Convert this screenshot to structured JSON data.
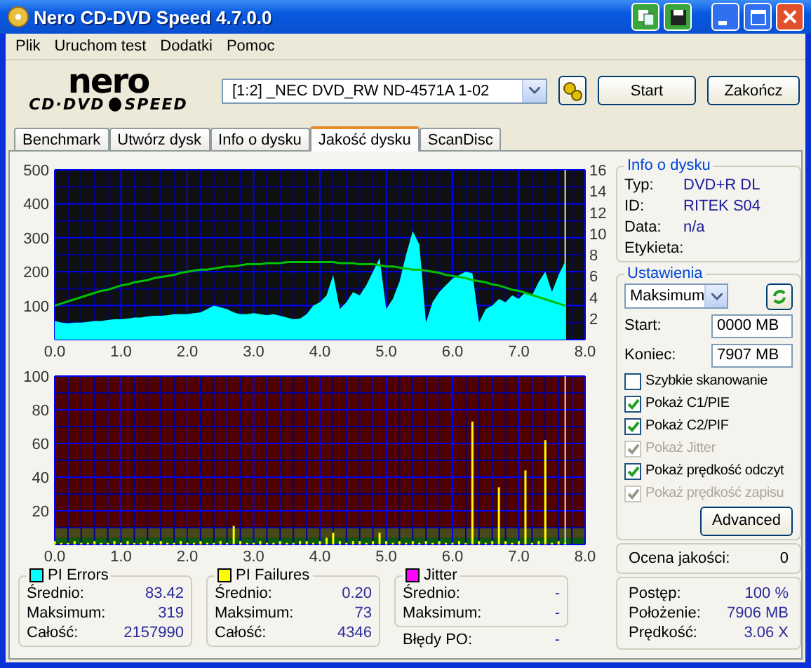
{
  "window": {
    "title": "Nero CD-DVD Speed 4.7.0.0"
  },
  "menu": [
    "Plik",
    "Uruchom test",
    "Dodatki",
    "Pomoc"
  ],
  "logo": {
    "top": "nero",
    "left": "CD·DVD",
    "right": "SPEED"
  },
  "drive": {
    "value": "[1:2]   _NEC DVD_RW ND-4571A 1-02"
  },
  "buttons": {
    "start": "Start",
    "exit": "Zakończ"
  },
  "tabs": [
    {
      "label": "Benchmark",
      "selected": false
    },
    {
      "label": "Utwórz dysk",
      "selected": false
    },
    {
      "label": "Info o dysku",
      "selected": false
    },
    {
      "label": "Jakość dysku",
      "selected": true
    },
    {
      "label": "ScanDisc",
      "selected": false
    }
  ],
  "pi_chart": {
    "chart_data": {
      "type": "area",
      "xlim": [
        0,
        8
      ],
      "ylim": [
        0,
        500
      ],
      "xticks": [
        {
          "value": 0,
          "label": "0.0"
        },
        {
          "value": 1,
          "label": "1.0"
        },
        {
          "value": 2,
          "label": "2.0"
        },
        {
          "value": 3,
          "label": "3.0"
        },
        {
          "value": 4,
          "label": "4.0"
        },
        {
          "value": 5,
          "label": "5.0"
        },
        {
          "value": 6,
          "label": "6.0"
        },
        {
          "value": 7,
          "label": "7.0"
        },
        {
          "value": 8,
          "label": "8.0"
        }
      ],
      "yticks": [
        100,
        200,
        300,
        400,
        500
      ],
      "y2lim": [
        0,
        16
      ],
      "grid": true,
      "y2ticks": [
        2,
        4,
        6,
        8,
        10,
        12,
        14,
        16
      ],
      "x": [
        0.0,
        0.1,
        0.2,
        0.3,
        0.4,
        0.5,
        0.6,
        0.7,
        0.8,
        0.9,
        1.0,
        1.1,
        1.2,
        1.3,
        1.4,
        1.5,
        1.6,
        1.7,
        1.8,
        1.9,
        2.0,
        2.1,
        2.2,
        2.3,
        2.4,
        2.5,
        2.6,
        2.7,
        2.8,
        2.9,
        3.0,
        3.1,
        3.2,
        3.3,
        3.4,
        3.5,
        3.6,
        3.7,
        3.8,
        3.9,
        4.0,
        4.1,
        4.2,
        4.3,
        4.4,
        4.5,
        4.6,
        4.7,
        4.8,
        4.9,
        5.0,
        5.1,
        5.2,
        5.3,
        5.4,
        5.5,
        5.6,
        5.7,
        5.8,
        5.9,
        6.0,
        6.1,
        6.2,
        6.3,
        6.4,
        6.5,
        6.6,
        6.7,
        6.8,
        6.9,
        7.0,
        7.1,
        7.2,
        7.3,
        7.4,
        7.5,
        7.6,
        7.7
      ],
      "series": [
        {
          "color": "#00ffff",
          "type": "area",
          "values": [
            55,
            50,
            48,
            50,
            50,
            52,
            55,
            55,
            58,
            60,
            60,
            62,
            65,
            65,
            68,
            70,
            70,
            72,
            75,
            75,
            75,
            78,
            80,
            90,
            100,
            95,
            90,
            80,
            75,
            75,
            78,
            75,
            72,
            75,
            70,
            65,
            60,
            62,
            75,
            100,
            110,
            130,
            190,
            90,
            110,
            140,
            130,
            160,
            200,
            240,
            90,
            120,
            170,
            250,
            319,
            280,
            50,
            110,
            140,
            160,
            180,
            190,
            200,
            195,
            50,
            90,
            100,
            120,
            110,
            130,
            120,
            140,
            130,
            170,
            200,
            140,
            190,
            230
          ]
        },
        {
          "color": "#00c000",
          "type": "line",
          "axis": "y2",
          "values": [
            3.2,
            3.4,
            3.6,
            3.8,
            4.0,
            4.2,
            4.4,
            4.6,
            4.7,
            4.9,
            5.1,
            5.2,
            5.4,
            5.5,
            5.6,
            5.8,
            5.9,
            6.0,
            6.1,
            6.3,
            6.4,
            6.5,
            6.6,
            6.6,
            6.7,
            6.8,
            6.9,
            6.9,
            7.0,
            7.1,
            7.1,
            7.1,
            7.2,
            7.2,
            7.2,
            7.3,
            7.3,
            7.3,
            7.3,
            7.3,
            7.3,
            7.3,
            7.3,
            7.2,
            7.2,
            7.2,
            7.1,
            7.1,
            7.1,
            7.0,
            6.9,
            6.9,
            6.8,
            6.7,
            6.6,
            6.6,
            6.5,
            6.4,
            6.3,
            6.1,
            6.0,
            5.9,
            5.8,
            5.6,
            5.5,
            5.4,
            5.2,
            5.1,
            4.9,
            4.7,
            4.6,
            4.4,
            4.2,
            4.0,
            3.8,
            3.6,
            3.4,
            3.2
          ]
        }
      ]
    }
  },
  "pif_chart": {
    "chart_data": {
      "type": "bar",
      "xlim": [
        0,
        8
      ],
      "ylim": [
        0,
        100
      ],
      "xticks": [
        {
          "value": 0,
          "label": "0.0"
        },
        {
          "value": 1,
          "label": "1.0"
        },
        {
          "value": 2,
          "label": "2.0"
        },
        {
          "value": 3,
          "label": "3.0"
        },
        {
          "value": 4,
          "label": "4.0"
        },
        {
          "value": 5,
          "label": "5.0"
        },
        {
          "value": 6,
          "label": "6.0"
        },
        {
          "value": 7,
          "label": "7.0"
        },
        {
          "value": 8,
          "label": "8.0"
        }
      ],
      "yticks": [
        20,
        40,
        60,
        80,
        100
      ],
      "grid": true,
      "x": [
        0.0,
        0.1,
        0.2,
        0.3,
        0.4,
        0.5,
        0.6,
        0.7,
        0.8,
        0.9,
        1.0,
        1.1,
        1.2,
        1.3,
        1.4,
        1.5,
        1.6,
        1.7,
        1.8,
        1.9,
        2.0,
        2.1,
        2.2,
        2.3,
        2.4,
        2.5,
        2.6,
        2.7,
        2.8,
        2.9,
        3.0,
        3.1,
        3.2,
        3.3,
        3.4,
        3.5,
        3.6,
        3.7,
        3.8,
        3.9,
        4.0,
        4.1,
        4.2,
        4.3,
        4.4,
        4.5,
        4.6,
        4.7,
        4.8,
        4.9,
        5.0,
        5.1,
        5.2,
        5.3,
        5.4,
        5.5,
        5.6,
        5.7,
        5.8,
        5.9,
        6.0,
        6.1,
        6.2,
        6.3,
        6.4,
        6.5,
        6.6,
        6.7,
        6.8,
        6.9,
        7.0,
        7.1,
        7.2,
        7.3,
        7.4,
        7.5,
        7.6,
        7.7
      ],
      "series": [
        {
          "color": "#ffff00",
          "values": [
            2,
            1,
            1,
            2,
            1,
            1,
            2,
            1,
            1,
            2,
            1,
            2,
            1,
            1,
            2,
            1,
            2,
            1,
            1,
            2,
            1,
            1,
            2,
            1,
            1,
            2,
            1,
            11,
            2,
            1,
            1,
            2,
            1,
            1,
            2,
            1,
            1,
            2,
            2,
            1,
            2,
            4,
            7,
            2,
            1,
            2,
            2,
            1,
            2,
            7,
            2,
            1,
            2,
            1,
            2,
            1,
            2,
            1,
            2,
            1,
            1,
            2,
            1,
            73,
            2,
            1,
            2,
            34,
            2,
            1,
            2,
            44,
            1,
            2,
            62,
            1,
            2,
            1
          ]
        }
      ]
    }
  },
  "disc_info": {
    "title": "Info o dysku",
    "rows": [
      {
        "label": "Typ:",
        "value": "DVD+R DL"
      },
      {
        "label": "ID:",
        "value": "RITEK S04"
      },
      {
        "label": "Data:",
        "value": "n/a"
      },
      {
        "label": "Etykieta:"
      }
    ]
  },
  "settings": {
    "title": "Ustawienia",
    "speed": "Maksimum",
    "start_label": "Start:",
    "start": "0000 MB",
    "end_label": "Koniec:",
    "end": "7907 MB",
    "options": [
      {
        "label": "Szybkie skanowanie",
        "checked": false,
        "disabled": false
      },
      {
        "label": "Pokaż C1/PIE",
        "checked": true,
        "disabled": false
      },
      {
        "label": "Pokaż C2/PIF",
        "checked": true,
        "disabled": false
      },
      {
        "label": "Pokaż Jitter",
        "checked": true,
        "disabled": true
      },
      {
        "label": "Pokaż prędkość odczyt",
        "checked": true,
        "disabled": false
      },
      {
        "label": "Pokaż prędkość zapisu",
        "checked": true,
        "disabled": true
      }
    ],
    "advanced": "Advanced"
  },
  "quality": {
    "label": "Ocena jakości:",
    "value": "0"
  },
  "progress": [
    {
      "label": "Postęp:",
      "value": "100 %"
    },
    {
      "label": "Położenie:",
      "value": "7906 MB"
    },
    {
      "label": "Prędkość:",
      "value": "3.06 X"
    }
  ],
  "stats": [
    {
      "title": "PI Errors",
      "color": "#00ffff",
      "rows": [
        {
          "label": "Średnio:",
          "value": "83.42"
        },
        {
          "label": "Maksimum:",
          "value": "319"
        },
        {
          "label": "Całość:",
          "value": "2157990"
        }
      ]
    },
    {
      "title": "PI Failures",
      "color": "#ffff00",
      "rows": [
        {
          "label": "Średnio:",
          "value": "0.20"
        },
        {
          "label": "Maksimum:",
          "value": "73"
        },
        {
          "label": "Całość:",
          "value": "4346"
        }
      ]
    },
    {
      "title": "Jitter",
      "color": "#ff00ff",
      "rows": [
        {
          "label": "Średnio:",
          "value": "-"
        },
        {
          "label": "Maksimum:",
          "value": "-"
        }
      ],
      "extra": {
        "label": "Błędy PO:",
        "value": "-"
      }
    }
  ]
}
